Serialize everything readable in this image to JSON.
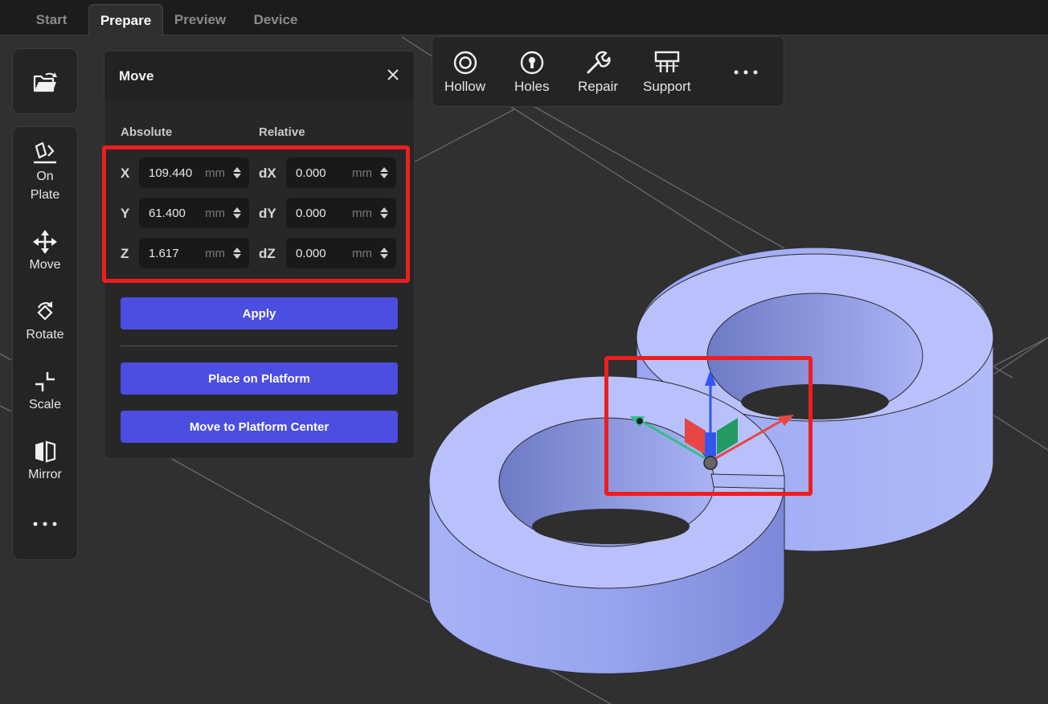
{
  "tabs": [
    {
      "label": "Start",
      "active": false
    },
    {
      "label": "Prepare",
      "active": true
    },
    {
      "label": "Preview",
      "active": false
    },
    {
      "label": "Device",
      "active": false
    }
  ],
  "left_toolbar": {
    "tools": [
      {
        "label": "On\nPlate",
        "icon": "on-plate-icon"
      },
      {
        "label": "Move",
        "icon": "move-icon"
      },
      {
        "label": "Rotate",
        "icon": "rotate-icon"
      },
      {
        "label": "Scale",
        "icon": "scale-icon"
      },
      {
        "label": "Mirror",
        "icon": "mirror-icon"
      },
      {
        "label": "",
        "icon": "more-icon"
      }
    ],
    "open_icon": "open-file-icon"
  },
  "move_panel": {
    "title": "Move",
    "absolute_label": "Absolute",
    "relative_label": "Relative",
    "rows": [
      {
        "axis": "X",
        "value": "109.440",
        "rel_axis": "dX",
        "rel_value": "0.000",
        "unit": "mm"
      },
      {
        "axis": "Y",
        "value": "61.400",
        "rel_axis": "dY",
        "rel_value": "0.000",
        "unit": "mm"
      },
      {
        "axis": "Z",
        "value": "1.617",
        "rel_axis": "dZ",
        "rel_value": "0.000",
        "unit": "mm"
      }
    ],
    "apply_label": "Apply",
    "place_label": "Place on Platform",
    "center_label": "Move to Platform Center"
  },
  "top_toolbar": {
    "items": [
      {
        "label": "Hollow",
        "icon": "hollow-icon"
      },
      {
        "label": "Holes",
        "icon": "holes-icon"
      },
      {
        "label": "Repair",
        "icon": "repair-icon"
      },
      {
        "label": "Support",
        "icon": "support-icon"
      }
    ],
    "more_icon": "more-icon"
  },
  "colors": {
    "accent": "#4b4ee0",
    "model": "#b4bdfb",
    "highlight": "#ef1d1d",
    "axis_x": "#e84545",
    "axis_y": "#2fc08a",
    "axis_z": "#3355f0"
  }
}
